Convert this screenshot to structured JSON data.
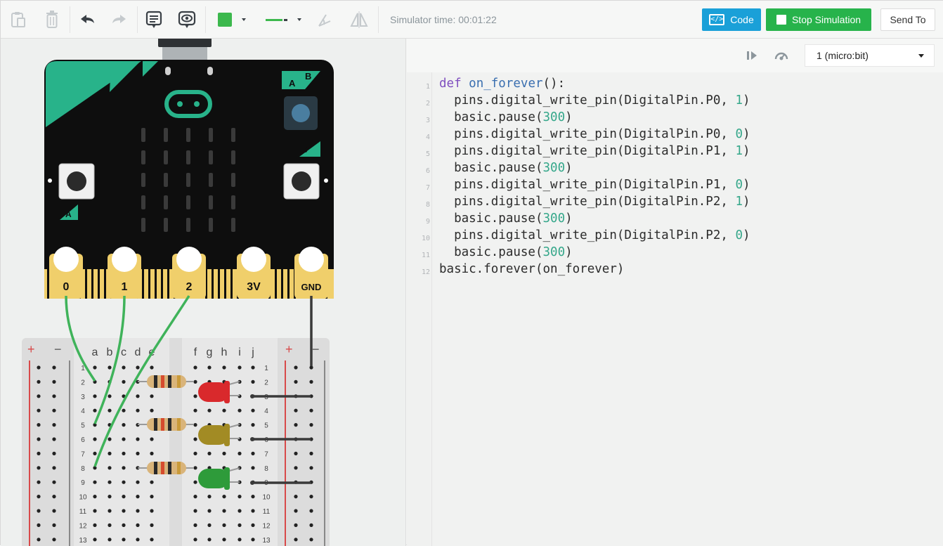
{
  "toolbar": {
    "icons": [
      "paste-icon",
      "delete-icon",
      "undo-icon",
      "redo-icon",
      "notes-icon",
      "view-icon",
      "color-swatch-icon",
      "wire-style-icon",
      "rotate-icon",
      "flip-icon"
    ],
    "simulator_time": "Simulator time: 00:01:22",
    "code_label": "Code",
    "stop_label": "Stop Simulation",
    "send_label": "Send To",
    "accent_blue": "#1aa0d8",
    "accent_green": "#27b34b"
  },
  "code_panel": {
    "device_select": "1 (micro:bit)",
    "line_numbers": [
      "1",
      "2",
      "3",
      "4",
      "5",
      "6",
      "7",
      "8",
      "9",
      "10",
      "11",
      "12"
    ],
    "lines": [
      "def on_forever():",
      "  pins.digital_write_pin(DigitalPin.P0, 1)",
      "  basic.pause(300)",
      "  pins.digital_write_pin(DigitalPin.P0, 0)",
      "  pins.digital_write_pin(DigitalPin.P1, 1)",
      "  basic.pause(300)",
      "  pins.digital_write_pin(DigitalPin.P1, 0)",
      "  pins.digital_write_pin(DigitalPin.P2, 1)",
      "  basic.pause(300)",
      "  pins.digital_write_pin(DigitalPin.P2, 0)",
      "  basic.pause(300)",
      "basic.forever(on_forever)"
    ]
  },
  "microbit": {
    "button_a": "A",
    "button_b": "B",
    "pins": [
      "0",
      "1",
      "2",
      "3V",
      "GND"
    ],
    "board_color": "#0e0e0e",
    "accent_color": "#28b38a",
    "edge_color": "#f0cf6b"
  },
  "breadboard": {
    "col_letters": [
      "a",
      "b",
      "c",
      "d",
      "e",
      "f",
      "g",
      "h",
      "i",
      "j"
    ],
    "row_numbers": [
      "1",
      "2",
      "3",
      "4",
      "5",
      "6",
      "7",
      "8",
      "9",
      "10",
      "11",
      "12",
      "13"
    ],
    "plus": "+",
    "minus": "−",
    "leds": [
      {
        "color": "#d9292c"
      },
      {
        "color": "#a28b24"
      },
      {
        "color": "#2e9b3a"
      }
    ]
  }
}
